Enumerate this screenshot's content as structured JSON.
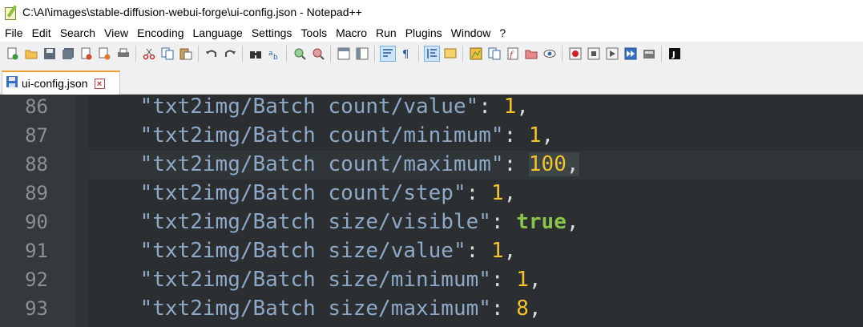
{
  "window": {
    "title": "C:\\AI\\images\\stable-diffusion-webui-forge\\ui-config.json - Notepad++"
  },
  "menu": [
    "File",
    "Edit",
    "Search",
    "View",
    "Encoding",
    "Language",
    "Settings",
    "Tools",
    "Macro",
    "Run",
    "Plugins",
    "Window",
    "?"
  ],
  "toolbar": {
    "icons": [
      "new-file-icon",
      "open-file-icon",
      "save-icon",
      "save-all-icon",
      "close-icon",
      "close-all-icon",
      "print-icon",
      "cut-icon",
      "copy-icon",
      "paste-icon",
      "undo-icon",
      "redo-icon",
      "find-icon",
      "replace-icon",
      "zoom-in-icon",
      "zoom-out-icon",
      "sync-vertical-icon",
      "sync-horizontal-icon",
      "word-wrap-icon",
      "show-all-chars-icon",
      "indent-guide-icon",
      "user-language-icon",
      "doc-map-icon",
      "doc-list-icon",
      "function-list-icon",
      "folder-workspace-icon",
      "monitoring-icon",
      "record-macro-icon",
      "stop-macro-icon",
      "play-macro-icon",
      "run-macro-multiple-icon",
      "save-macro-icon",
      "json-viewer-icon"
    ]
  },
  "tab": {
    "label": "ui-config.json",
    "close": "×"
  },
  "editor": {
    "colors": {
      "background": "#2b2f31",
      "string": "#8ea8c8",
      "number": "#f4c32c",
      "boolean": "#88c34a",
      "line_number": "#8b9094"
    },
    "lines": [
      {
        "num": "86",
        "key": "\"txt2img/Batch count/value\"",
        "sep": ": ",
        "value": "1",
        "type": "number",
        "comma": ","
      },
      {
        "num": "87",
        "key": "\"txt2img/Batch count/minimum\"",
        "sep": ": ",
        "value": "1",
        "type": "number",
        "comma": ","
      },
      {
        "num": "88",
        "key": "\"txt2img/Batch count/maximum\"",
        "sep": ": ",
        "value": "100",
        "type": "number",
        "comma": ",",
        "current": true
      },
      {
        "num": "89",
        "key": "\"txt2img/Batch count/step\"",
        "sep": ": ",
        "value": "1",
        "type": "number",
        "comma": ","
      },
      {
        "num": "90",
        "key": "\"txt2img/Batch size/visible\"",
        "sep": ": ",
        "value": "true",
        "type": "bool",
        "comma": ","
      },
      {
        "num": "91",
        "key": "\"txt2img/Batch size/value\"",
        "sep": ": ",
        "value": "1",
        "type": "number",
        "comma": ","
      },
      {
        "num": "92",
        "key": "\"txt2img/Batch size/minimum\"",
        "sep": ": ",
        "value": "1",
        "type": "number",
        "comma": ","
      },
      {
        "num": "93",
        "key": "\"txt2img/Batch size/maximum\"",
        "sep": ": ",
        "value": "8",
        "type": "number",
        "comma": ","
      }
    ]
  }
}
